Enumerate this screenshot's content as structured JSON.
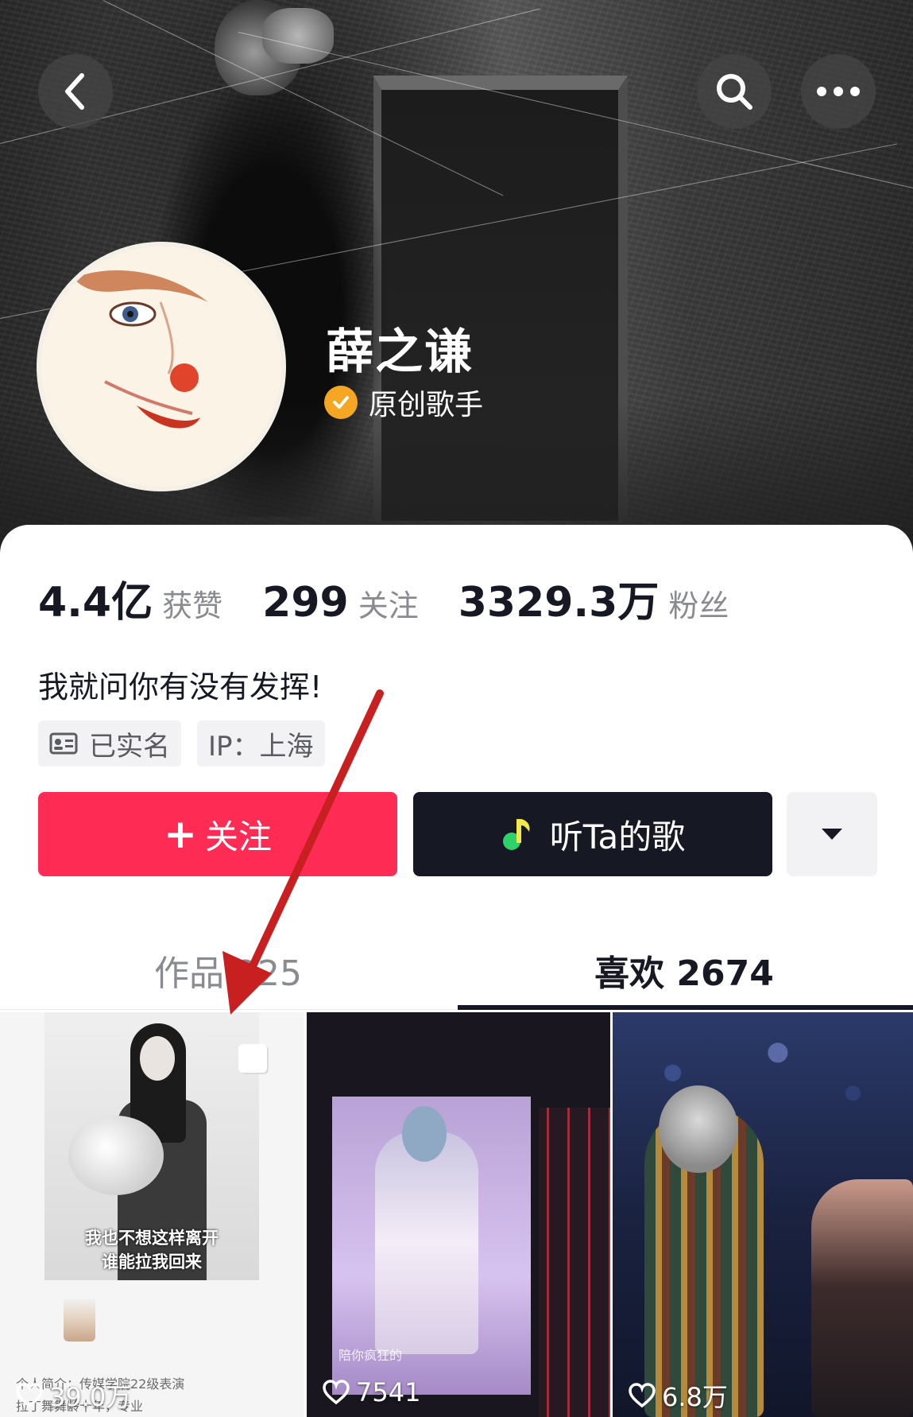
{
  "profile": {
    "name": "薛之谦",
    "verify_label": "原创歌手",
    "bio": "我就问你有没有发挥!"
  },
  "stats": [
    {
      "value": "4.4亿",
      "label": "获赞"
    },
    {
      "value": "299",
      "label": "关注"
    },
    {
      "value": "3329.3万",
      "label": "粉丝"
    }
  ],
  "tags": {
    "realname": "已实名",
    "ip": "IP：上海"
  },
  "actions": {
    "follow_label": "关注",
    "music_label": "听Ta的歌"
  },
  "tabs": {
    "works": "作品 225",
    "likes": "喜欢 2674"
  },
  "grid": [
    {
      "caption_1": "我也不想这样离开",
      "caption_2": "谁能拉我回来",
      "intro": "个人简介：传媒学院22级表演　　　　　　　　　　　拉丁舞舞龄十年，专业",
      "likes": "39.0万"
    },
    {
      "caption": "陪你疯狂的",
      "likes": "7541"
    },
    {
      "likes": "6.8万"
    }
  ],
  "colors": {
    "follow": "#fe2c55",
    "music": "#161823",
    "verify": "#f5a623",
    "annotation_arrow": "#c82020"
  }
}
